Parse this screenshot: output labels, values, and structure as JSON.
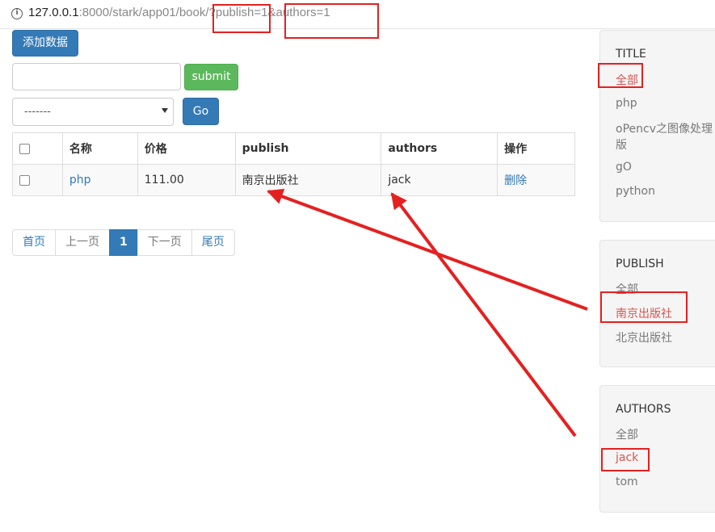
{
  "browser": {
    "url_host": "127.0.0.1",
    "url_rest": ":8000/stark/app01/book/?publish=1&authors=1"
  },
  "toolbar": {
    "add_label": "添加数据",
    "search_value": "",
    "submit_label": "submit",
    "action_select_value": "-------",
    "go_label": "Go"
  },
  "table": {
    "headers": [
      "名称",
      "价格",
      "publish",
      "authors",
      "操作"
    ],
    "rows": [
      {
        "name": "php",
        "price": "111.00",
        "publish": "南京出版社",
        "authors": "jack",
        "action": "删除"
      }
    ]
  },
  "pagination": {
    "first": "首页",
    "prev": "上一页",
    "current": "1",
    "next": "下一页",
    "last": "尾页"
  },
  "filters": {
    "title": {
      "heading": "TITLE",
      "items": [
        "全部",
        "php",
        "oPencv之图像处理 (",
        "版",
        "gO",
        "python"
      ]
    },
    "publish": {
      "heading": "PUBLISH",
      "items": [
        "全部",
        "南京出版社",
        "北京出版社"
      ]
    },
    "authors": {
      "heading": "AUTHORS",
      "items": [
        "全部",
        "jack",
        "tom"
      ]
    }
  },
  "colors": {
    "primary": "#337ab7",
    "success": "#5cb85c",
    "selected_filter": "#d9534f",
    "annotation": "#e52020"
  }
}
